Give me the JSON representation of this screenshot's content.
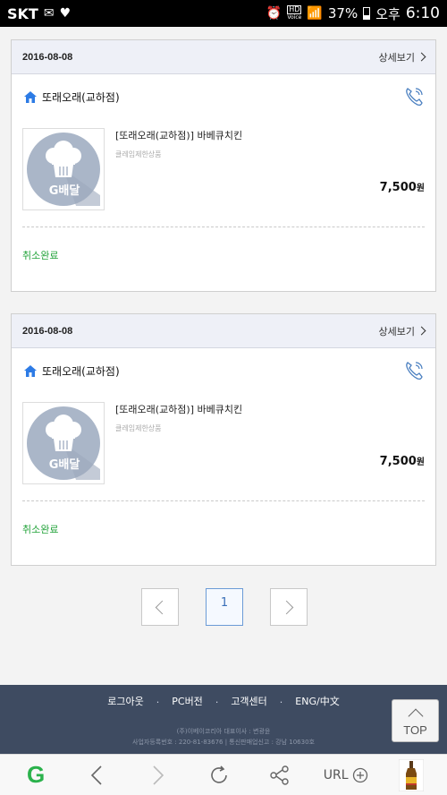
{
  "status_bar": {
    "carrier": "SKT",
    "battery": "37%",
    "ampm": "오후",
    "time": "6:10",
    "hd_label": "HD",
    "voice_label": "Voice"
  },
  "orders": [
    {
      "date": "2016-08-08",
      "detail_label": "상세보기",
      "store_name": "또래오래(교하점)",
      "item_name": "[또래오래(교하점)] 바베큐치킨",
      "item_sub": "클레임제한상품",
      "price": "7,500",
      "currency": "원",
      "status": "취소완료",
      "thumb_label": "G배달"
    },
    {
      "date": "2016-08-08",
      "detail_label": "상세보기",
      "store_name": "또래오래(교하점)",
      "item_name": "[또래오래(교하점)] 바베큐치킨",
      "item_sub": "클레임제한상품",
      "price": "7,500",
      "currency": "원",
      "status": "취소완료",
      "thumb_label": "G배달"
    }
  ],
  "pagination": {
    "current": "1"
  },
  "footer": {
    "links": [
      "로그아웃",
      "PC버전",
      "고객센터",
      "ENG/中文"
    ],
    "separator": ".",
    "info_line1": "(주)이베이코리아 대표이사 : 변광윤",
    "info_line2": "사업자등록번호 : 220-81-83676 | 통신판매업신고 : 강남 10630호"
  },
  "top_button": {
    "label": "TOP"
  },
  "browser_toolbar": {
    "logo": "G",
    "url_label": "URL"
  },
  "colors": {
    "status_green": "#22a33a",
    "footer_bg": "#3e4b61",
    "page_link": "#6b9bd6"
  }
}
